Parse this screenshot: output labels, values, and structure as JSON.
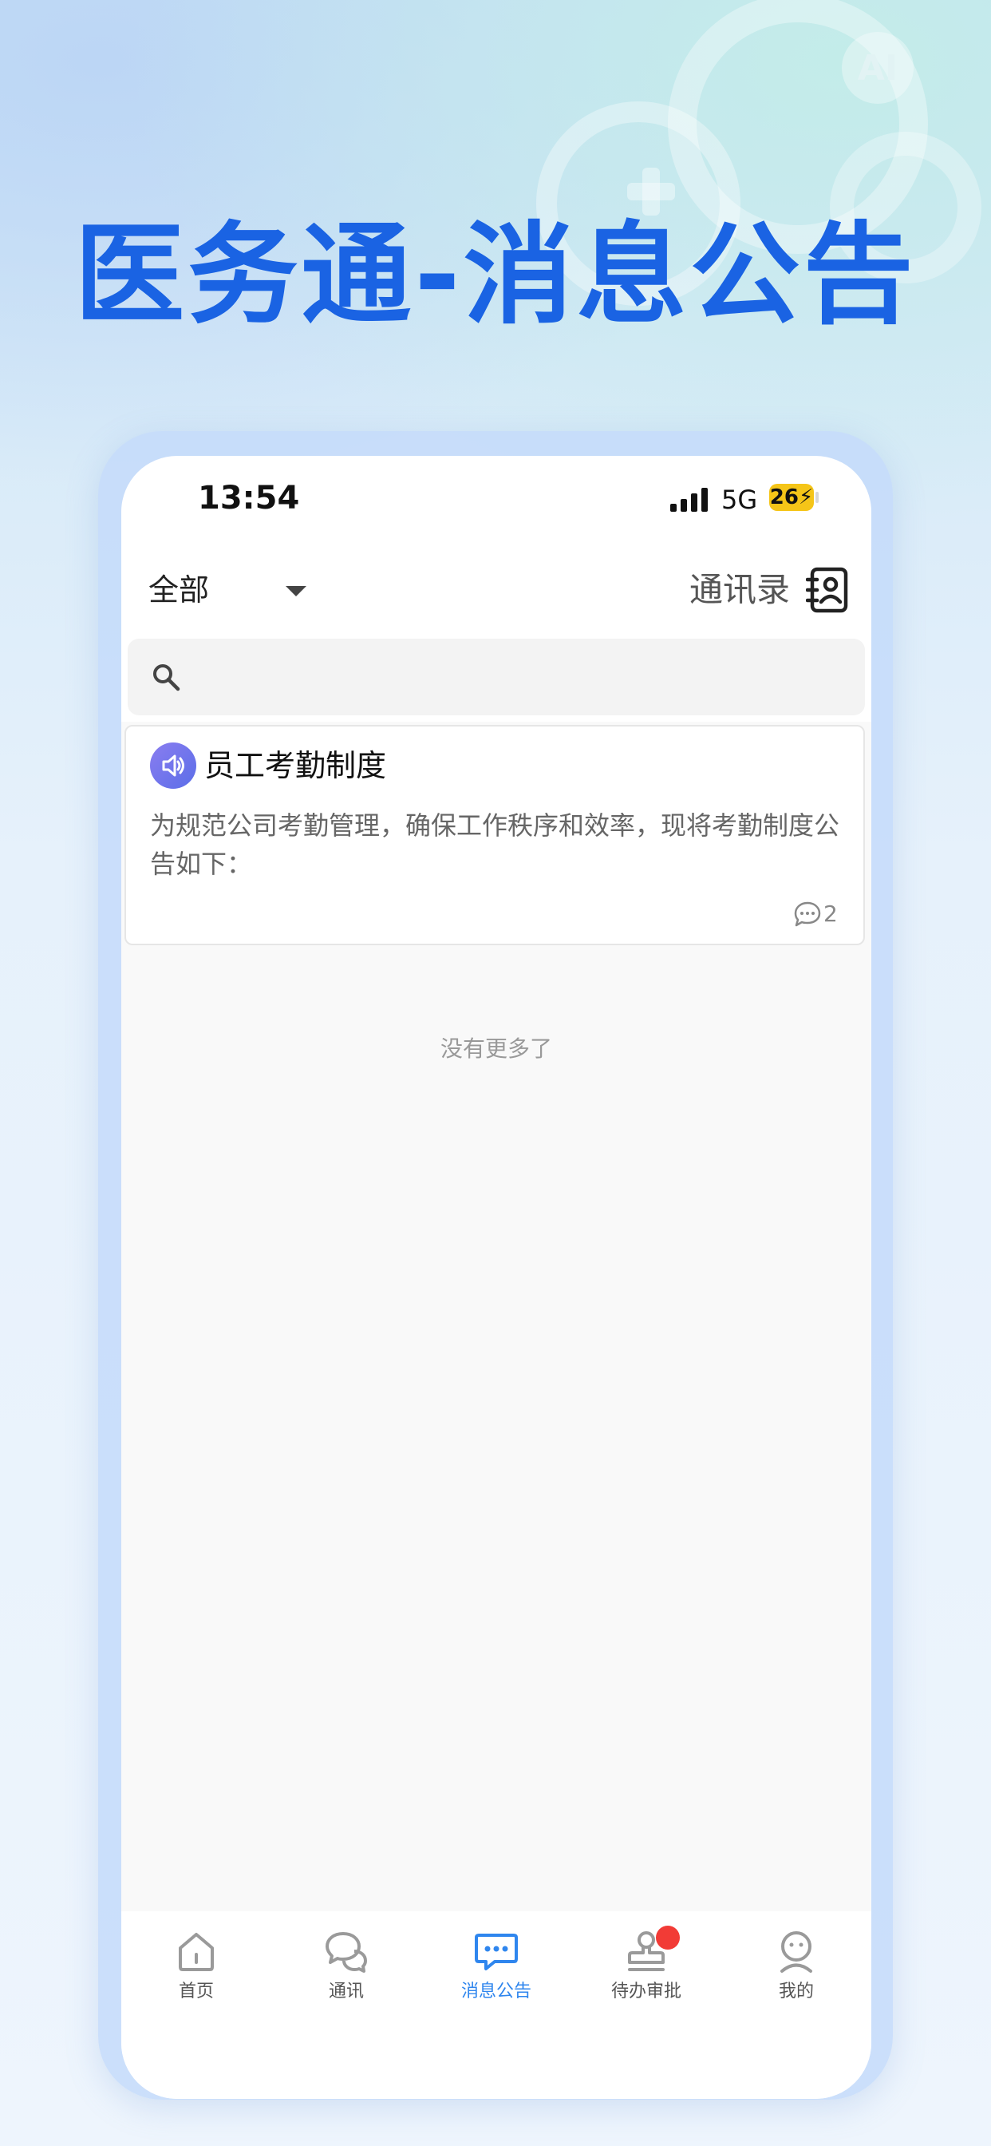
{
  "headline": "医务通-消息公告",
  "deco": {
    "ai_logo_text": "AI"
  },
  "status_bar": {
    "time": "13:54",
    "network": "5G",
    "battery": "26"
  },
  "topbar": {
    "filter_label": "全部",
    "contacts_label": "通讯录"
  },
  "search": {
    "placeholder": ""
  },
  "announcements": [
    {
      "title": "员工考勤制度",
      "body": "为规范公司考勤管理，确保工作秩序和效率，现将考勤制度公告如下：",
      "comment_count": "2"
    }
  ],
  "list_end_text": "没有更多了",
  "tabs": [
    {
      "label": "首页",
      "icon": "home-icon",
      "active": false
    },
    {
      "label": "通讯",
      "icon": "chat-bubbles-icon",
      "active": false
    },
    {
      "label": "消息公告",
      "icon": "message-icon",
      "active": true
    },
    {
      "label": "待办审批",
      "icon": "stamp-icon",
      "active": false,
      "badge": true
    },
    {
      "label": "我的",
      "icon": "profile-icon",
      "active": false
    }
  ],
  "colors": {
    "accent": "#2f86ee",
    "headline": "#1a63e3",
    "badge": "#f23b36",
    "announcement_icon": "#6d74ec"
  }
}
